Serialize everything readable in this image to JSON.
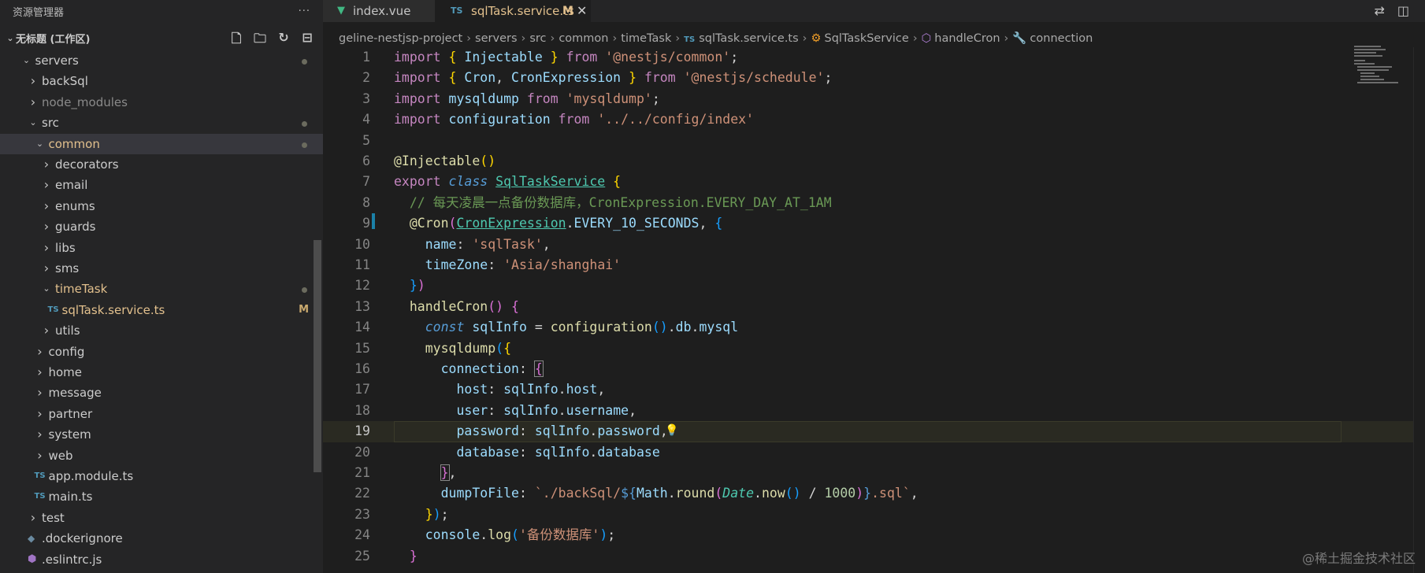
{
  "sidebar": {
    "title": "资源管理器",
    "more": "···",
    "workspace": "无标题 (工作区)",
    "workspace_actions": [
      "new-file",
      "new-folder",
      "refresh",
      "collapse-all"
    ],
    "tree": [
      {
        "label": "servers",
        "depth": 1,
        "type": "folder-open",
        "dot": true
      },
      {
        "label": "backSql",
        "depth": 2,
        "type": "folder"
      },
      {
        "label": "node_modules",
        "depth": 2,
        "type": "folder",
        "muted": true
      },
      {
        "label": "src",
        "depth": 2,
        "type": "folder-open",
        "dot": true
      },
      {
        "label": "common",
        "depth": 3,
        "type": "folder-open",
        "dot": true,
        "active": true,
        "yellow": true
      },
      {
        "label": "decorators",
        "depth": 4,
        "type": "folder"
      },
      {
        "label": "email",
        "depth": 4,
        "type": "folder"
      },
      {
        "label": "enums",
        "depth": 4,
        "type": "folder"
      },
      {
        "label": "guards",
        "depth": 4,
        "type": "folder"
      },
      {
        "label": "libs",
        "depth": 4,
        "type": "folder"
      },
      {
        "label": "sms",
        "depth": 4,
        "type": "folder"
      },
      {
        "label": "timeTask",
        "depth": 4,
        "type": "folder-open",
        "dot": true,
        "yellow": true
      },
      {
        "label": "sqlTask.service.ts",
        "depth": 5,
        "type": "ts",
        "badge": "M",
        "yellow": true
      },
      {
        "label": "utils",
        "depth": 4,
        "type": "folder"
      },
      {
        "label": "config",
        "depth": 3,
        "type": "folder"
      },
      {
        "label": "home",
        "depth": 3,
        "type": "folder"
      },
      {
        "label": "message",
        "depth": 3,
        "type": "folder"
      },
      {
        "label": "partner",
        "depth": 3,
        "type": "folder"
      },
      {
        "label": "system",
        "depth": 3,
        "type": "folder"
      },
      {
        "label": "web",
        "depth": 3,
        "type": "folder"
      },
      {
        "label": "app.module.ts",
        "depth": 3,
        "type": "ts"
      },
      {
        "label": "main.ts",
        "depth": 3,
        "type": "ts"
      },
      {
        "label": "test",
        "depth": 2,
        "type": "folder"
      },
      {
        "label": ".dockerignore",
        "depth": 2,
        "type": "docker"
      },
      {
        "label": ".eslintrc.js",
        "depth": 2,
        "type": "eslint"
      }
    ]
  },
  "tabs": {
    "index": {
      "label": "index.vue"
    },
    "active": {
      "icon": "TS",
      "label": "sqlTask.service.ts",
      "badge": "M",
      "close": "✕"
    }
  },
  "breadcrumb": {
    "parts": [
      "geline-nestjsp-project",
      "servers",
      "src",
      "common",
      "timeTask"
    ],
    "file_icon": "TS",
    "file": "sqlTask.service.ts",
    "class": "SqlTaskService",
    "method": "handleCron",
    "symbol": "connection"
  },
  "editor": {
    "current_line": 19,
    "line_numbers": [
      1,
      2,
      3,
      4,
      5,
      6,
      7,
      8,
      9,
      10,
      11,
      12,
      13,
      14,
      15,
      16,
      17,
      18,
      19,
      20,
      21,
      22,
      23,
      24,
      25
    ]
  },
  "colors": {
    "accent_modified": "#e2c08d",
    "typescript": "#519aba",
    "vue": "#41b883"
  },
  "watermark": "@稀土掘金技术社区"
}
